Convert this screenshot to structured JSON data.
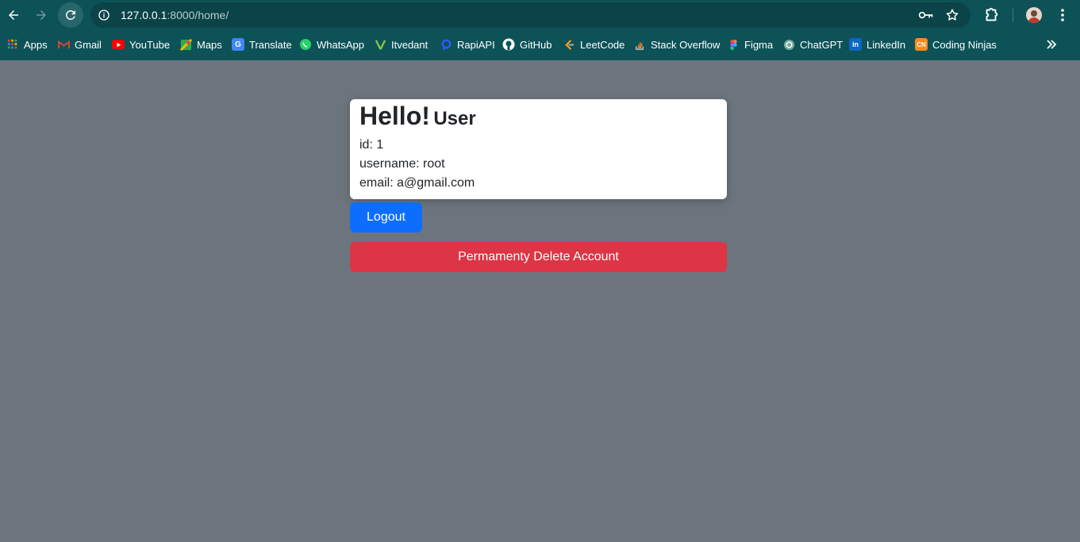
{
  "browser": {
    "url_host": "127.0.0.1",
    "url_path": ":8000/home/"
  },
  "bookmarks": [
    {
      "label": "Apps",
      "icon": "apps-grid-icon",
      "color": "#ea4335"
    },
    {
      "label": "Gmail",
      "icon": "gmail-icon",
      "color": "#ea4335"
    },
    {
      "label": "YouTube",
      "icon": "youtube-icon",
      "color": "#ff0000"
    },
    {
      "label": "Maps",
      "icon": "maps-icon",
      "color": "#34a853"
    },
    {
      "label": "Translate",
      "icon": "translate-icon",
      "color": "#4285f4"
    },
    {
      "label": "WhatsApp",
      "icon": "whatsapp-icon",
      "color": "#25d366"
    },
    {
      "label": "Itvedant",
      "icon": "itvedant-icon",
      "color": "#8bc34a"
    },
    {
      "label": "RapiAPI",
      "icon": "rapidapi-icon",
      "color": "#2d5bff"
    },
    {
      "label": "GitHub",
      "icon": "github-icon",
      "color": "#ffffff"
    },
    {
      "label": "LeetCode",
      "icon": "leetcode-icon",
      "color": "#ffa116"
    },
    {
      "label": "Stack Overflow",
      "icon": "stackoverflow-icon",
      "color": "#f48024"
    },
    {
      "label": "Figma",
      "icon": "figma-icon",
      "color": "#f24e1e"
    },
    {
      "label": "ChatGPT",
      "icon": "chatgpt-icon",
      "color": "#74aa9c"
    },
    {
      "label": "LinkedIn",
      "icon": "linkedin-icon",
      "color": "#0a66c2"
    },
    {
      "label": "Coding Ninjas",
      "icon": "coding-ninjas-icon",
      "color": "#f78a1d"
    }
  ],
  "card": {
    "greeting": "Hello!",
    "name": "User",
    "id_line": "id: 1",
    "username_line": "username: root",
    "email_line": "email: a@gmail.com"
  },
  "actions": {
    "logout_label": "Logout",
    "delete_label": "Permamenty Delete Account"
  },
  "colors": {
    "page_bg": "#6c757d",
    "chrome_bg": "#0d5257",
    "primary": "#0d6efd",
    "danger": "#dc3545"
  }
}
